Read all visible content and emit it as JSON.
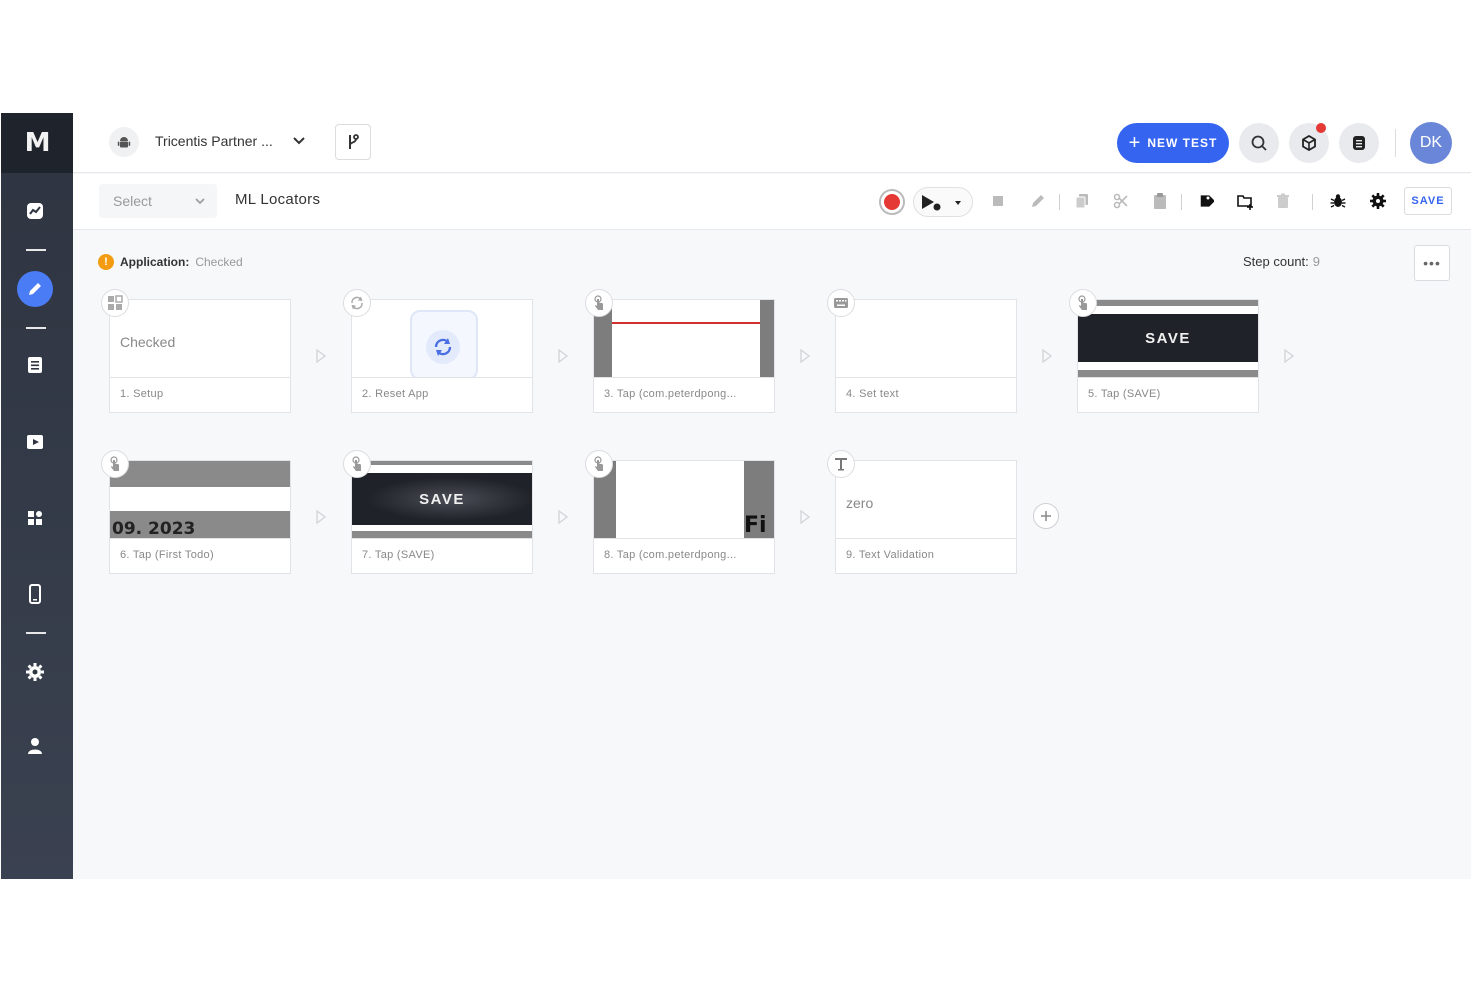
{
  "header": {
    "project_name": "Tricentis Partner ...",
    "new_test_label": "NEW TEST",
    "avatar_initials": "DK"
  },
  "toolbar": {
    "select_label": "Select",
    "test_title": "ML Locators",
    "save_label": "SAVE"
  },
  "meta": {
    "application_label": "Application:",
    "application_value": "Checked",
    "step_count_label": "Step count:",
    "step_count_value": "9",
    "more_label": "•••"
  },
  "steps": [
    {
      "caption": "1. Setup",
      "thumb_text": "Checked",
      "icon": "setup-grid-icon"
    },
    {
      "caption": "2. Reset App",
      "thumb_text": "",
      "icon": "reset-icon"
    },
    {
      "caption": "3. Tap (com.peterdpong...",
      "thumb_text": "",
      "icon": "tap-icon"
    },
    {
      "caption": "4. Set text",
      "thumb_text": "",
      "icon": "keyboard-icon"
    },
    {
      "caption": "5. Tap (SAVE)",
      "thumb_text": "SAVE",
      "icon": "tap-icon"
    },
    {
      "caption": "6. Tap (First Todo)",
      "thumb_text": "09. 2023",
      "icon": "tap-icon"
    },
    {
      "caption": "7. Tap (SAVE)",
      "thumb_text": "SAVE",
      "icon": "tap-icon"
    },
    {
      "caption": "8. Tap (com.peterdpong...",
      "thumb_text": "Fi",
      "icon": "tap-icon"
    },
    {
      "caption": "9. Text Validation",
      "thumb_text": "zero",
      "icon": "text-icon"
    }
  ],
  "colors": {
    "accent": "#3564f0",
    "record": "#e53935",
    "warning": "#f39c12",
    "sidebar": "#2e3440"
  }
}
